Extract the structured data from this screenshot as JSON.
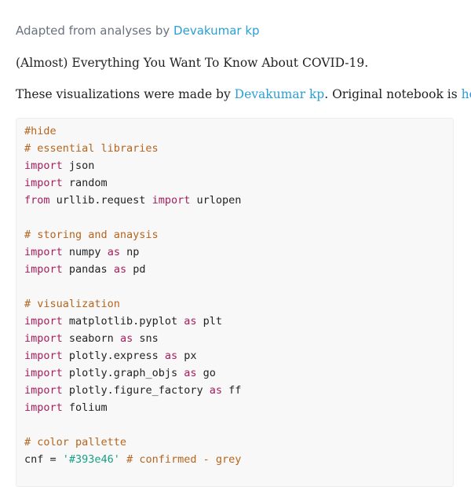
{
  "header": {
    "byline_prefix": "Adapted from analyses by ",
    "byline_author": "Devakumar kp"
  },
  "intro": {
    "title_line": "(Almost) Everything You Want To Know About COVID-19.",
    "credit_prefix": "These visualizations were made by ",
    "credit_author": "Devakumar kp",
    "credit_middle": ".  Original notebook is ",
    "credit_link": "here",
    "credit_end": "."
  },
  "code": {
    "lines": [
      [
        {
          "t": "cm",
          "v": "#hide"
        }
      ],
      [
        {
          "t": "cm",
          "v": "# essential libraries"
        }
      ],
      [
        {
          "t": "kw",
          "v": "import"
        },
        {
          "t": "n",
          "v": " json"
        }
      ],
      [
        {
          "t": "kw",
          "v": "import"
        },
        {
          "t": "n",
          "v": " random"
        }
      ],
      [
        {
          "t": "kw",
          "v": "from"
        },
        {
          "t": "n",
          "v": " urllib.request "
        },
        {
          "t": "kw",
          "v": "import"
        },
        {
          "t": "n",
          "v": " urlopen"
        }
      ],
      [],
      [
        {
          "t": "cm",
          "v": "# storing and anaysis"
        }
      ],
      [
        {
          "t": "kw",
          "v": "import"
        },
        {
          "t": "n",
          "v": " numpy "
        },
        {
          "t": "kw",
          "v": "as"
        },
        {
          "t": "n",
          "v": " np"
        }
      ],
      [
        {
          "t": "kw",
          "v": "import"
        },
        {
          "t": "n",
          "v": " pandas "
        },
        {
          "t": "kw",
          "v": "as"
        },
        {
          "t": "n",
          "v": " pd"
        }
      ],
      [],
      [
        {
          "t": "cm",
          "v": "# visualization"
        }
      ],
      [
        {
          "t": "kw",
          "v": "import"
        },
        {
          "t": "n",
          "v": " matplotlib.pyplot "
        },
        {
          "t": "kw",
          "v": "as"
        },
        {
          "t": "n",
          "v": " plt"
        }
      ],
      [
        {
          "t": "kw",
          "v": "import"
        },
        {
          "t": "n",
          "v": " seaborn "
        },
        {
          "t": "kw",
          "v": "as"
        },
        {
          "t": "n",
          "v": " sns"
        }
      ],
      [
        {
          "t": "kw",
          "v": "import"
        },
        {
          "t": "n",
          "v": " plotly.express "
        },
        {
          "t": "kw",
          "v": "as"
        },
        {
          "t": "n",
          "v": " px"
        }
      ],
      [
        {
          "t": "kw",
          "v": "import"
        },
        {
          "t": "n",
          "v": " plotly.graph_objs "
        },
        {
          "t": "kw",
          "v": "as"
        },
        {
          "t": "n",
          "v": " go"
        }
      ],
      [
        {
          "t": "kw",
          "v": "import"
        },
        {
          "t": "n",
          "v": " plotly.figure_factory "
        },
        {
          "t": "kw",
          "v": "as"
        },
        {
          "t": "n",
          "v": " ff"
        }
      ],
      [
        {
          "t": "kw",
          "v": "import"
        },
        {
          "t": "n",
          "v": " folium"
        }
      ],
      [],
      [
        {
          "t": "cm",
          "v": "# color pallette"
        }
      ],
      [
        {
          "t": "n",
          "v": "cnf = "
        },
        {
          "t": "st",
          "v": "'#393e46'"
        },
        {
          "t": "n",
          "v": " "
        },
        {
          "t": "cm",
          "v": "# confirmed - grey"
        }
      ]
    ]
  },
  "colors": {
    "link": "#2a9fd6",
    "comment": "#b5651d",
    "keyword": "#a71d5d",
    "string": "#16a085",
    "code_bg": "#f8f8f8"
  }
}
